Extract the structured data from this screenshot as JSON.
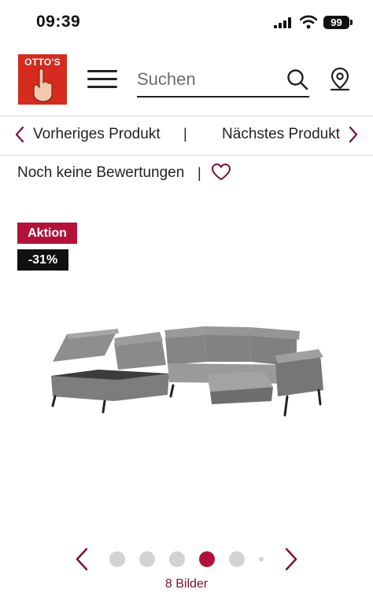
{
  "status_bar": {
    "time": "09:39",
    "battery": "99"
  },
  "header": {
    "logo_text": "OTTO'S",
    "search_placeholder": "Suchen"
  },
  "product_nav": {
    "prev_label": "Vorheriges Produkt",
    "separator": "|",
    "next_label": "Nächstes Produkt"
  },
  "rating": {
    "label": "Noch keine Bewertungen",
    "separator": "|"
  },
  "badges": {
    "promo": "Aktion",
    "discount": "-31%"
  },
  "carousel": {
    "image_count_label": "8 Bilder",
    "total_dots": 5,
    "active_index": 3
  },
  "colors": {
    "brand_red": "#d52b1e",
    "accent": "#b2123a",
    "dot_inactive": "#d3d3d3"
  },
  "icons": [
    "signal-icon",
    "wifi-icon",
    "hamburger-menu-icon",
    "search-icon",
    "location-pin-icon",
    "chevron-left-icon",
    "chevron-right-icon",
    "heart-icon"
  ]
}
